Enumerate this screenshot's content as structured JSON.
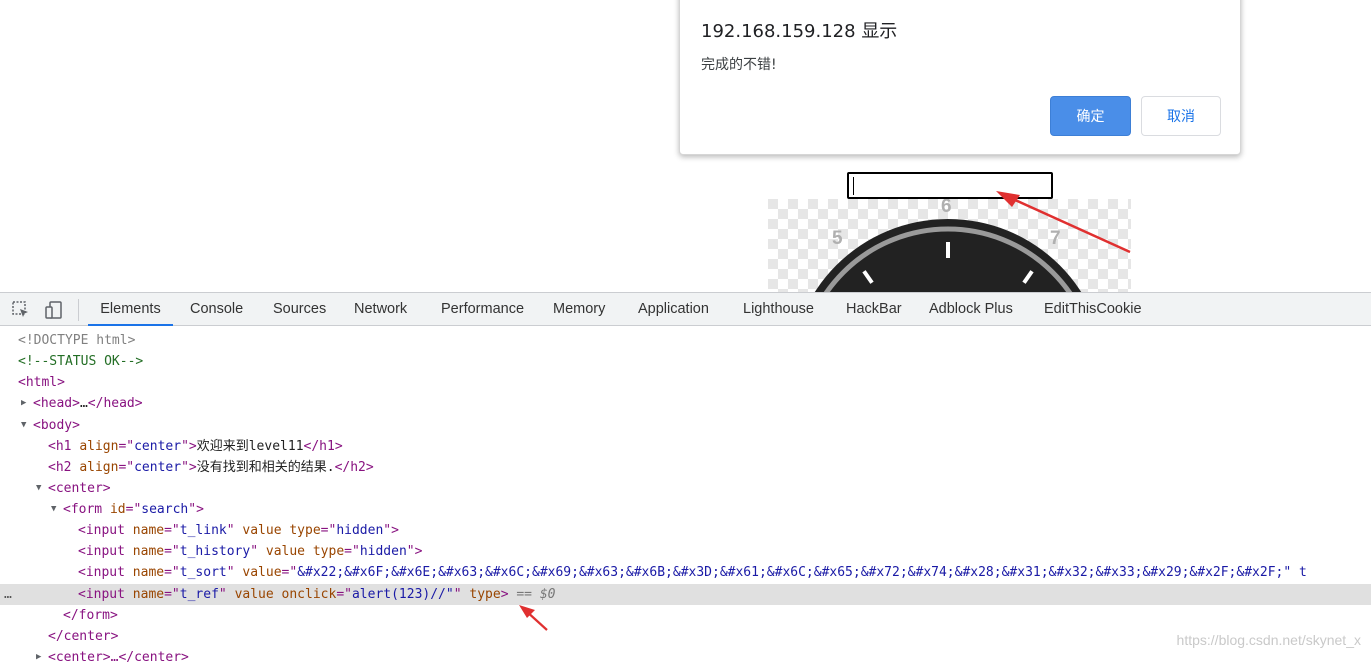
{
  "dialog": {
    "title": "192.168.159.128 显示",
    "message": "完成的不错!",
    "ok_label": "确定",
    "cancel_label": "取消"
  },
  "page": {
    "clock_numbers": [
      "5",
      "6",
      "7"
    ]
  },
  "devtools": {
    "tabs": [
      "Elements",
      "Console",
      "Sources",
      "Network",
      "Performance",
      "Memory",
      "Application",
      "Lighthouse",
      "HackBar",
      "Adblock Plus",
      "EditThisCookie"
    ],
    "active_tab": "Elements",
    "tree": {
      "doctype": "<!DOCTYPE html>",
      "comment": "<!--STATUS OK-->",
      "html_open": "<html>",
      "head": [
        "<head>",
        "…",
        "</head>"
      ],
      "body_open": "<body>",
      "h1": {
        "open": "<h1 ",
        "attr": "align",
        "eq": "=\"",
        "val": "center",
        "close": "\">",
        "text": "欢迎来到level11",
        "end": "</h1>"
      },
      "h2": {
        "open": "<h2 ",
        "attr": "align",
        "eq": "=\"",
        "val": "center",
        "close": "\">",
        "text": "没有找到和相关的结果.",
        "end": "</h2>"
      },
      "center_open": "<center>",
      "form": {
        "open": "<form ",
        "attr": "id",
        "eq": "=\"",
        "val": "search",
        "close": "\">"
      },
      "input1": {
        "name": "t_link",
        "rest_attr": "value type",
        "type_val": "hidden"
      },
      "input2": {
        "name": "t_history",
        "rest_attr": "value type",
        "type_val": "hidden"
      },
      "input3": {
        "name": "t_sort",
        "value": "&#x22;&#x6F;&#x6E;&#x63;&#x6C;&#x69;&#x63;&#x6B;&#x3D;&#x61;&#x6C;&#x65;&#x72;&#x74;&#x28;&#x31;&#x32;&#x33;&#x29;&#x2F;&#x2F;\" t"
      },
      "input4": {
        "name": "t_ref",
        "onclick": "alert(123)//\"",
        "type": "type",
        "marker": "== $0"
      },
      "form_close": "</form>",
      "center_close": "</center>",
      "center2": "<center>…</center>"
    },
    "selected_dots": "…"
  },
  "watermark": "https://blog.csdn.net/skynet_x"
}
